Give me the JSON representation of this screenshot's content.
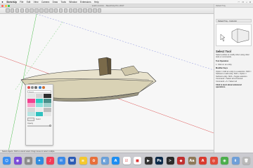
{
  "menubar": {
    "app_name": "SketchUp",
    "menus": [
      "File",
      "Edit",
      "View",
      "Camera",
      "Draw",
      "Tools",
      "Window",
      "Extensions",
      "Help"
    ],
    "status_icons": [
      "wifi-icon",
      "battery-icon",
      "search-icon",
      "control-center-icon"
    ]
  },
  "window": {
    "title": "... sushi.comics - SketchUp Pro 2017",
    "traffic_lights": [
      "#ff5f57",
      "#febc2e",
      "#28c840"
    ]
  },
  "toolbar": {
    "icons": [
      "select-tool-icon",
      "eraser-icon",
      "pencil-icon",
      "arc-icon",
      "rectangle-icon",
      "push-pull-icon",
      "move-icon",
      "rotate-icon",
      "scale-icon",
      "offset-icon",
      "tape-measure-icon",
      "text-icon",
      "paint-bucket-icon",
      "orbit-icon",
      "pan-icon",
      "zoom-icon",
      "zoom-extents-icon",
      "warehouse-icon",
      "extension-warehouse-icon",
      "layout-icon"
    ]
  },
  "tray": {
    "header": "Default Tray",
    "panel_label": "Default Tray - Instructor",
    "tool_title": "Select Tool",
    "intro": "Select entities to modify when using other tools or commands.",
    "tool_operation_label": "Tool Operation",
    "tool_operation_text": "1. Click on an entity.",
    "modifier_label": "Modifier Keys",
    "modifier_text": "Option = Add an entity to a selection. Shift = Subtract or add entity. Shift + Option = Subtract entity. Shift + Toggle selection. Command = Select all connected. Command + A = Select all",
    "more_label": "Click to learn about advanced operations."
  },
  "colors_panel": {
    "icons": [
      "color-wheel-icon",
      "color-sliders-icon",
      "color-palette-icon",
      "image-palette-icon",
      "crayons-icon"
    ],
    "search_placeholder": "Search",
    "swatches": [
      "#e6e6e6",
      "#d4d4d4",
      "#2f2f2f",
      "#f2418f",
      "#2ec9c2",
      "#4a8f8a",
      "#f7a8cc",
      "#8fe3de",
      "#9fd0cc",
      "#d8d8d8",
      "#ececec",
      "#bdbdbd",
      "#b7e5e3",
      "#2fc1bf",
      "#e8e8e8"
    ],
    "selected_label": "Select",
    "opacity_label": "Opacity"
  },
  "statusbar": {
    "text": "Select objects. Shift to extend select. Drag mouse to select multiple."
  },
  "dock": {
    "apps": [
      {
        "name": "finder-icon",
        "color": "#3a8ff0",
        "glyph": "☺"
      },
      {
        "name": "siri-icon",
        "color": "#7b4dd8",
        "glyph": "◉"
      },
      {
        "name": "launchpad-icon",
        "color": "#8a8a8a",
        "glyph": "▦"
      },
      {
        "name": "safari-icon",
        "color": "#2f8de0",
        "glyph": "✦"
      },
      {
        "name": "music-icon",
        "color": "#f33c58",
        "glyph": "♪"
      },
      {
        "name": "mail-icon",
        "color": "#3b8ae8",
        "glyph": "✉"
      },
      {
        "name": "word-icon",
        "color": "#2b5bb5",
        "glyph": "W"
      },
      {
        "name": "notes-icon",
        "color": "#f4c82e",
        "glyph": "≡"
      },
      {
        "name": "photos-icon",
        "color": "#e86f3a",
        "glyph": "✿"
      },
      {
        "name": "preview-icon",
        "color": "#6aa0d8",
        "glyph": "◧"
      },
      {
        "name": "app-store-icon",
        "color": "#1c8ef2",
        "glyph": "A"
      },
      {
        "name": "reminders-icon",
        "color": "#ffffff",
        "glyph": "☑"
      },
      {
        "name": "calendar-icon",
        "color": "#ffffff",
        "glyph": "■"
      },
      {
        "name": "video-editor-icon",
        "color": "#333333",
        "glyph": "▶"
      },
      {
        "name": "photoshop-icon",
        "color": "#0c2b4a",
        "glyph": "Ps"
      },
      {
        "name": "terminal-icon",
        "color": "#2b2b2b",
        "glyph": ">"
      },
      {
        "name": "sketchup-icon",
        "color": "#c23030",
        "glyph": "◆"
      },
      {
        "name": "dictionary-icon",
        "color": "#8f7a5a",
        "glyph": "Aa"
      },
      {
        "name": "pdf-icon",
        "color": "#d93a2f",
        "glyph": "A"
      },
      {
        "name": "acrobat-icon",
        "color": "#e14a3a",
        "glyph": "◎"
      },
      {
        "name": "chrome-icon",
        "color": "#4cae4c",
        "glyph": "◉"
      },
      {
        "name": "downloads-icon",
        "color": "#6f9fd8",
        "glyph": "⬇"
      },
      {
        "name": "trash-icon",
        "color": "#b9b9b9",
        "glyph": "🗑"
      }
    ]
  }
}
